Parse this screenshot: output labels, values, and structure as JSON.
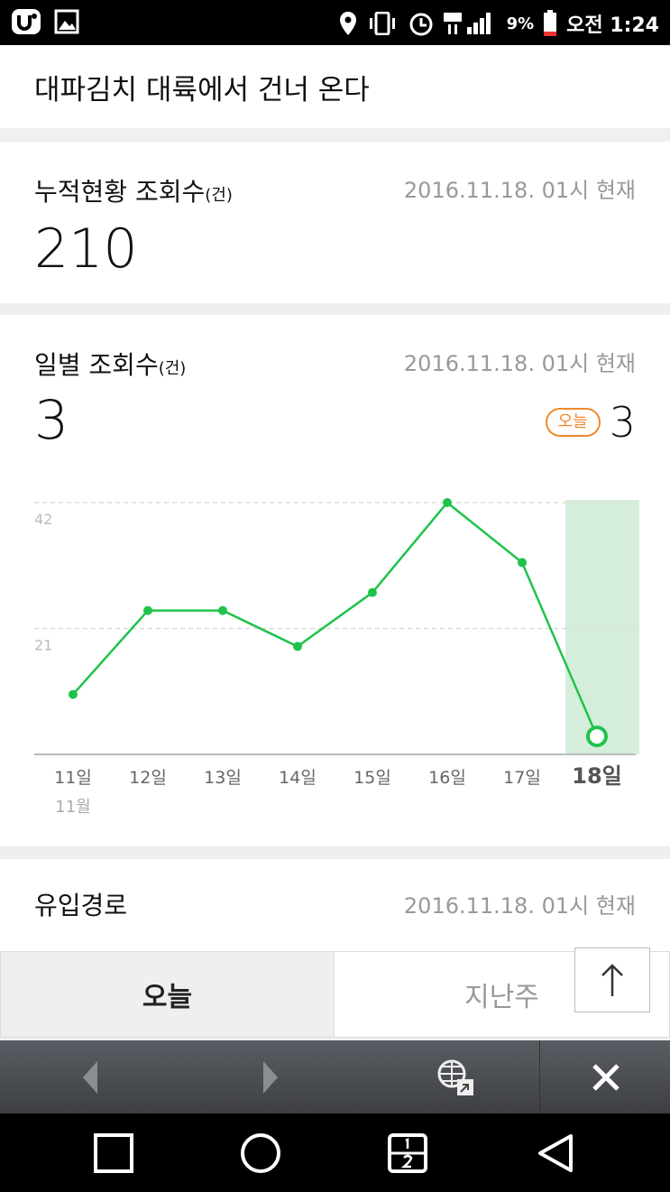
{
  "status": {
    "battery": "9%",
    "time": "오전 1:24",
    "network": "LTE"
  },
  "header": {
    "title": "대파김치 대륙에서 건너 온다"
  },
  "cumulative": {
    "title": "누적현황 조회수",
    "unit": "(건)",
    "timestamp": "2016.11.18. 01시 현재",
    "value": "210"
  },
  "daily": {
    "title": "일별 조회수",
    "unit": "(건)",
    "timestamp": "2016.11.18. 01시 현재",
    "value": "3",
    "today_label": "오늘",
    "today_value": "3"
  },
  "chart_data": {
    "type": "line",
    "categories": [
      "11일",
      "12일",
      "13일",
      "14일",
      "15일",
      "16일",
      "17일",
      "18일"
    ],
    "month_label": "11월",
    "values": [
      10,
      24,
      24,
      18,
      27,
      42,
      32,
      3
    ],
    "yticks": [
      21,
      42
    ],
    "ylim": [
      0,
      42
    ],
    "grid": true,
    "highlight_index": 7,
    "colors": {
      "line": "#1fc34a",
      "highlight": "#d5eedb",
      "grid": "#dddddd"
    }
  },
  "inflow": {
    "title": "유입경로",
    "timestamp": "2016.11.18. 01시 현재"
  },
  "tabs": {
    "today": "오늘",
    "last_week": "지난주"
  },
  "icons": {
    "top": "arrow-up-icon",
    "back": "triangle-left-icon",
    "forward": "triangle-right-icon",
    "globe": "globe-share-icon",
    "close": "close-icon"
  }
}
